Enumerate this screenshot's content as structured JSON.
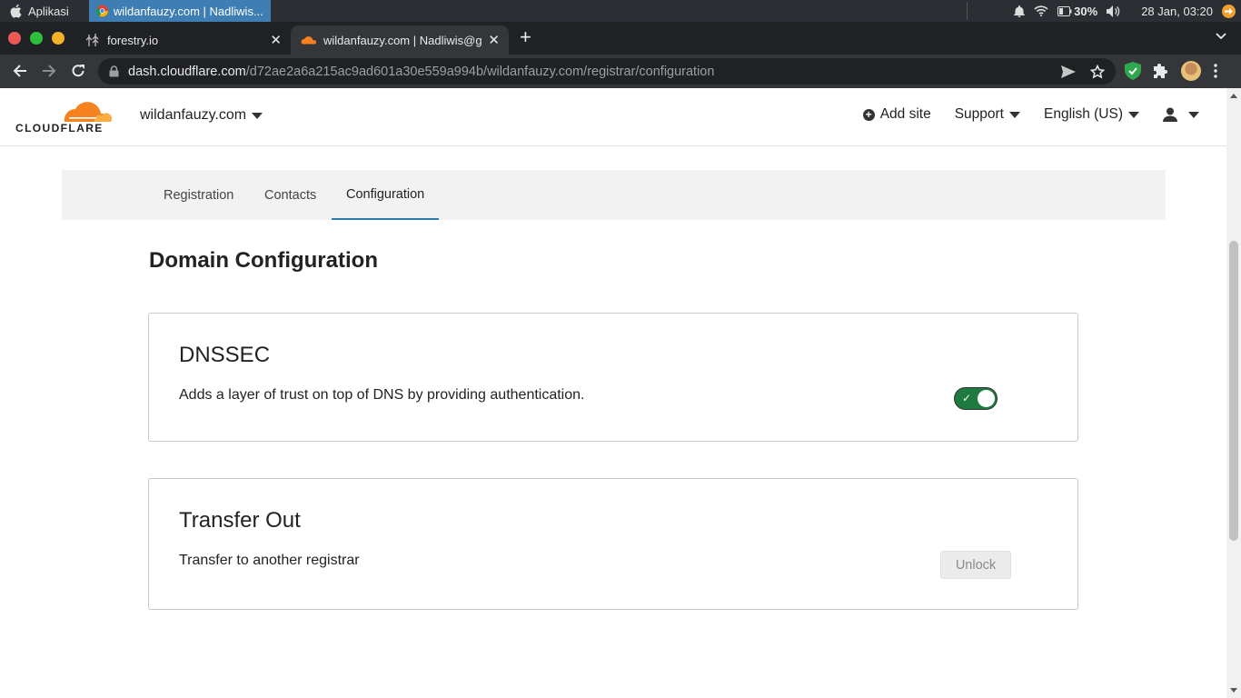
{
  "os": {
    "menu_label": "Aplikasi",
    "task_title": "wildanfauzy.com | Nadliwis...",
    "battery_pct": "30%",
    "datetime": "28 Jan, 03:20"
  },
  "browser": {
    "tabs": [
      {
        "title": "forestry.io",
        "close": "✕"
      },
      {
        "title": "wildanfauzy.com | Nadliwis@gm",
        "close": "✕"
      }
    ],
    "new_tab": "+",
    "url_host": "dash.cloudflare.com",
    "url_path": "/d72ae2a6a215ac9ad601a30e559a994b/wildanfauzy.com/registrar/configuration"
  },
  "header": {
    "logo_text": "CLOUDFLARE",
    "site": "wildanfauzy.com",
    "add_site": "Add site",
    "support": "Support",
    "language": "English (US)"
  },
  "subtabs": [
    {
      "label": "Registration"
    },
    {
      "label": "Contacts"
    },
    {
      "label": "Configuration"
    }
  ],
  "page": {
    "title": "Domain Configuration"
  },
  "dnssec": {
    "title": "DNSSEC",
    "description": "Adds a layer of trust on top of DNS by providing authentication.",
    "enabled": true,
    "check": "✓"
  },
  "transfer": {
    "title": "Transfer Out",
    "description": "Transfer to another registrar",
    "button": "Unlock"
  },
  "colors": {
    "toggle_on": "#1f7a3f",
    "cloudflare_orange": "#f6821f",
    "active_tab_underline": "#2c7cb0"
  }
}
